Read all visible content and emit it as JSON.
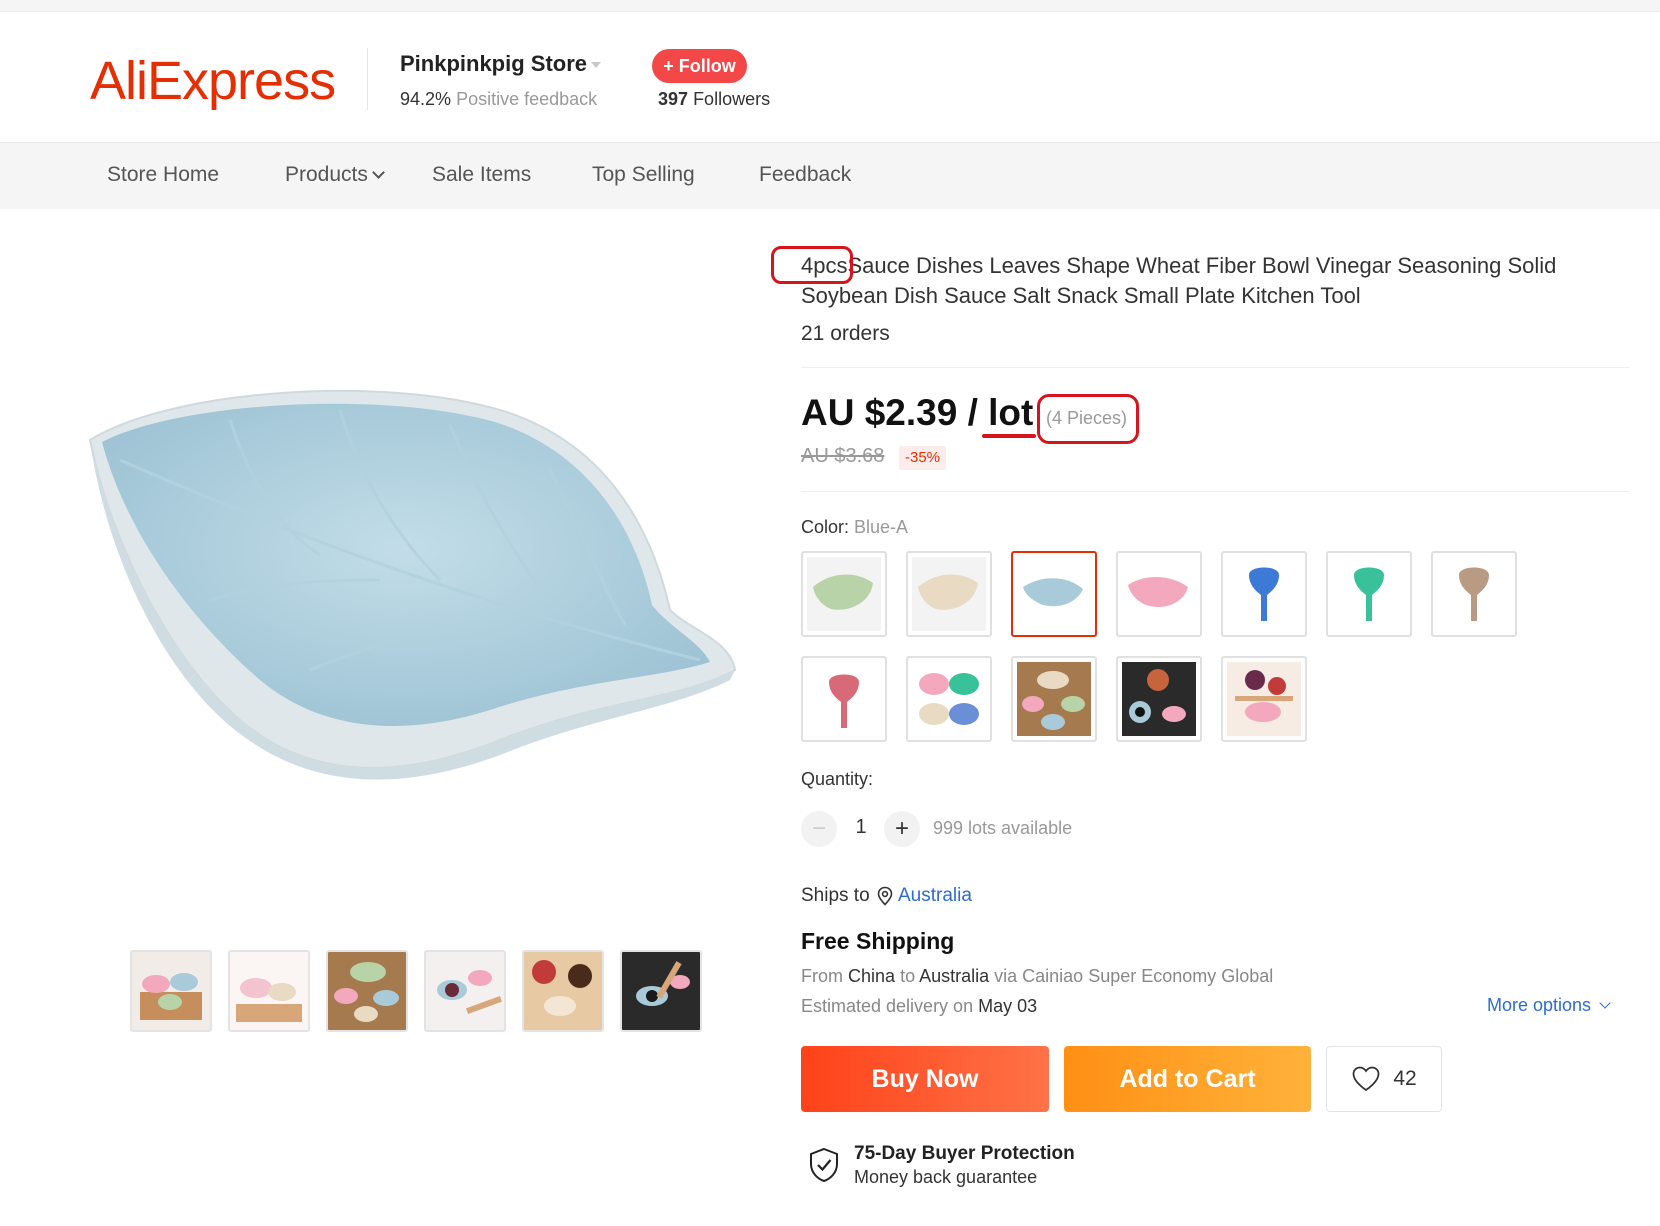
{
  "header": {
    "logo_text": "AliExpress",
    "store_name": "Pinkpinkpig Store",
    "feedback_percent": "94.2%",
    "feedback_label": "Positive feedback",
    "follow_label": "+ Follow",
    "followers_count": "397",
    "followers_label": "Followers"
  },
  "nav": {
    "items": [
      {
        "label": "Store Home"
      },
      {
        "label": "Products"
      },
      {
        "label": "Sale Items"
      },
      {
        "label": "Top Selling"
      },
      {
        "label": "Feedback"
      }
    ]
  },
  "product": {
    "title_prefix": "4pcs",
    "title_rest": "Sauce Dishes Leaves Shape Wheat Fiber Bowl Vinegar Seasoning Solid Soybean Dish Sauce Salt Snack Small Plate Kitchen Tool",
    "orders": "21 orders",
    "price": "AU $2.39 / lot",
    "pieces": "(4 Pieces)",
    "old_price": "AU $3.68",
    "discount": "-35%",
    "color_label": "Color:",
    "color_value": "Blue-A",
    "swatches": [
      {
        "name": "green-leaf",
        "color": "#b8d3a7"
      },
      {
        "name": "beige-leaf",
        "color": "#e9dac4"
      },
      {
        "name": "blue-leaf",
        "color": "#a9cad8",
        "selected": true
      },
      {
        "name": "pink-leaf",
        "color": "#f3a8bd"
      },
      {
        "name": "blue-spoon",
        "color": "#3d7ad6"
      },
      {
        "name": "green-spoon",
        "color": "#39c19a"
      },
      {
        "name": "khaki-spoon",
        "color": "#b99a83"
      },
      {
        "name": "red-spoon",
        "color": "#d86a78"
      },
      {
        "name": "four-bowls",
        "color": "#f3a8bd"
      },
      {
        "name": "set-photo-1",
        "color": "#a67a4f"
      },
      {
        "name": "set-photo-2",
        "color": "#2a2a2a"
      },
      {
        "name": "set-photo-3",
        "color": "#e7c4a8"
      }
    ],
    "quantity_label": "Quantity:",
    "quantity_value": "1",
    "quantity_available": "999 lots available",
    "ships_to_label": "Ships to",
    "ships_to_country": "Australia",
    "free_shipping": "Free Shipping",
    "ship_from_text": "From",
    "ship_from_origin": "China",
    "ship_from_to": "to",
    "ship_from_dest": "Australia",
    "ship_via": "via Cainiao Super Economy Global",
    "delivery_label": "Estimated delivery on",
    "delivery_date": "May 03",
    "more_options": "More options",
    "buy_now": "Buy Now",
    "add_to_cart": "Add to Cart",
    "wishlist_count": "42",
    "protection_title": "75-Day Buyer Protection",
    "protection_sub": "Money back guarantee"
  },
  "colors": {
    "brand": "#e62e04",
    "follow": "#f44848",
    "link": "#2e6ccf",
    "annotation": "#d7141b"
  }
}
